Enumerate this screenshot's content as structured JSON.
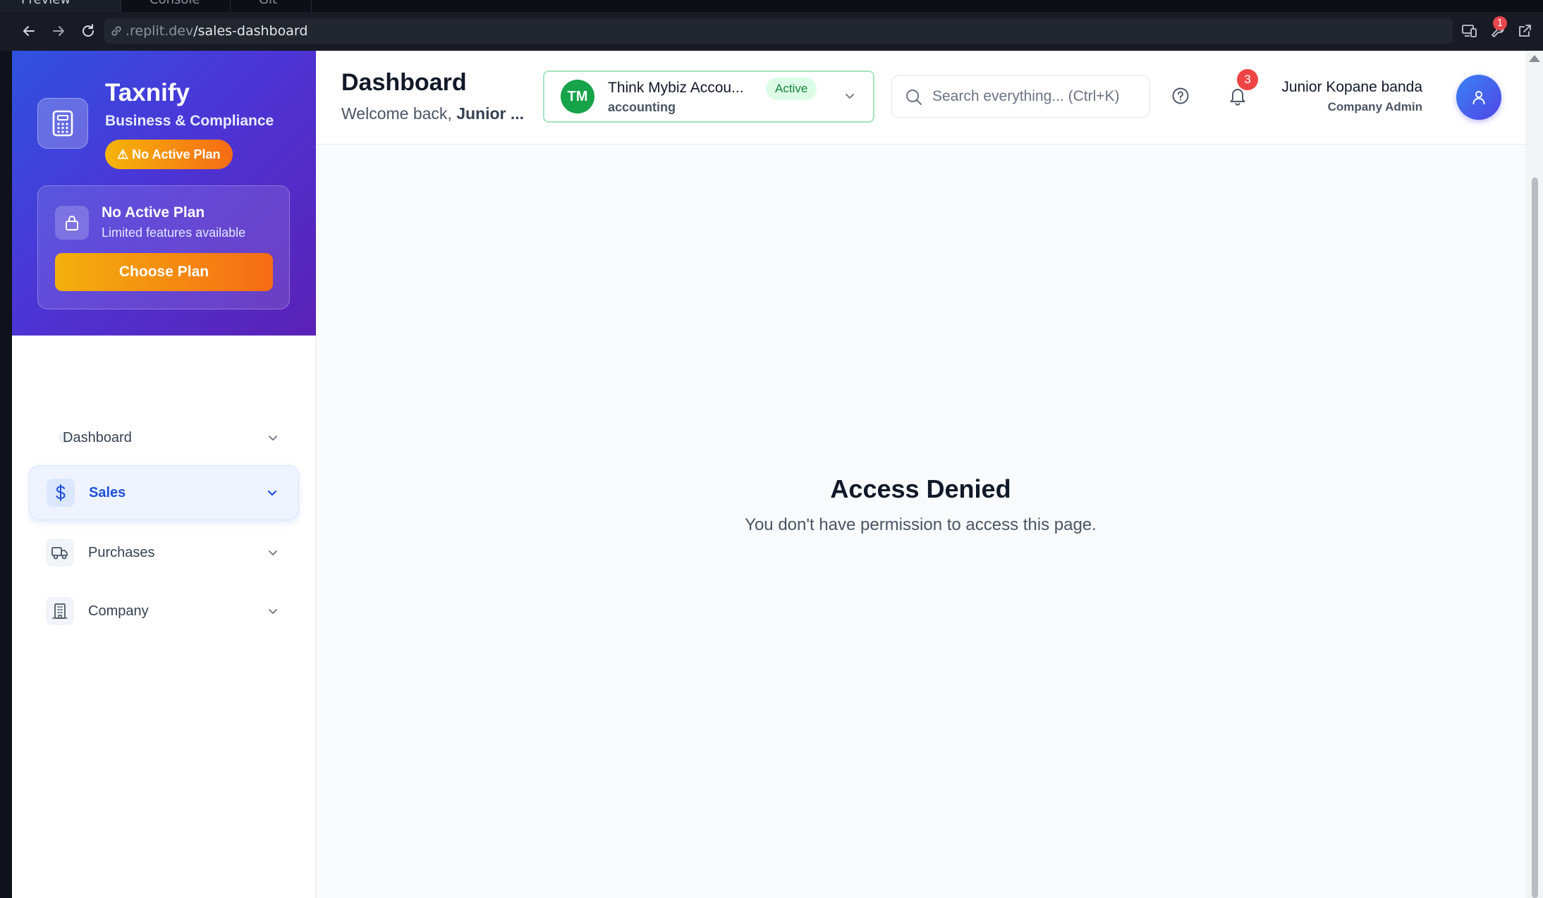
{
  "browser": {
    "tabs": [
      {
        "label": "Preview"
      },
      {
        "label": "Console"
      },
      {
        "label": "Git"
      }
    ],
    "url": {
      "host": ".replit.dev",
      "path": "/sales-dashboard"
    },
    "extensions_badge": "1"
  },
  "sidebar": {
    "brand_name": "Taxnify",
    "brand_subtitle": "Business & Compliance",
    "plan_badge": "⚠ No Active Plan",
    "plan_card": {
      "title": "No Active Plan",
      "description": "Limited features available",
      "button": "Choose Plan"
    },
    "nav": [
      {
        "label": "Dashboard",
        "icon": "dot-icon"
      },
      {
        "label": "Sales",
        "icon": "dollar-icon",
        "active": true
      },
      {
        "label": "Purchases",
        "icon": "truck-icon"
      },
      {
        "label": "Company",
        "icon": "building-icon"
      }
    ]
  },
  "header": {
    "title": "Dashboard",
    "welcome_prefix": "Welcome back,",
    "welcome_name": "Junior ...",
    "company": {
      "initials": "TM",
      "name": "Think Mybiz Accou...",
      "type": "accounting",
      "status": "Active"
    },
    "search_placeholder": "Search everything... (Ctrl+K)",
    "notifications_count": "3",
    "user": {
      "name": "Junior Kopane banda",
      "role": "Company Admin"
    }
  },
  "main": {
    "title": "Access Denied",
    "message": "You don't have permission to access this page."
  },
  "colors": {
    "brand_gradient_start": "#2f52e0",
    "brand_gradient_end": "#5b21b6",
    "accent_blue": "#1d4ed8",
    "plan_orange": "#f76b15",
    "active_green": "#16a34a",
    "notification_red": "#ef4444"
  }
}
